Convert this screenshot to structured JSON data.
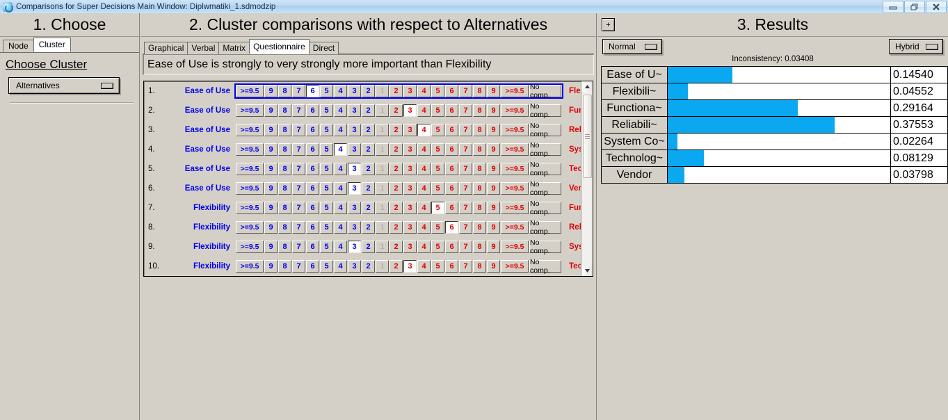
{
  "window": {
    "title": "Comparisons for Super Decisions Main Window: Diplwmatiki_1.sdmodzip",
    "icon": "app-refresh-icon",
    "controls": {
      "minimize": "minimize-icon",
      "restore": "restore-icon",
      "close": "close-icon"
    }
  },
  "left_panel": {
    "header": "1. Choose",
    "tabs": [
      {
        "label": "Node",
        "active": false
      },
      {
        "label": "Cluster",
        "active": true
      }
    ],
    "section_title": "Choose Cluster",
    "cluster_select": {
      "value": "Alternatives",
      "handle_icon": "dropdown-handle-icon"
    }
  },
  "middle_panel": {
    "header": "2. Cluster comparisons with respect to Alternatives",
    "tabs": [
      {
        "label": "Graphical",
        "active": false
      },
      {
        "label": "Verbal",
        "active": false
      },
      {
        "label": "Matrix",
        "active": false
      },
      {
        "label": "Questionnaire",
        "active": true
      },
      {
        "label": "Direct",
        "active": false
      }
    ],
    "prompt": "Ease of Use is strongly to very strongly more important than  Flexibility",
    "scale": {
      "left_labels": [
        ">=9.5",
        "9",
        "8",
        "7",
        "6",
        "5",
        "4",
        "3",
        "2"
      ],
      "center_label": "1",
      "right_labels": [
        "2",
        "3",
        "4",
        "5",
        "6",
        "7",
        "8",
        "9",
        ">=9.5"
      ],
      "no_comparison_label": "No comp.",
      "left_color": "#0000ee",
      "right_color": "#e00000",
      "center_color": "#b6b2ab"
    },
    "rows": [
      {
        "num": "1.",
        "left": "Ease of Use",
        "right": "Flexibility",
        "side": "left",
        "value": "6",
        "selected_row": true
      },
      {
        "num": "2.",
        "left": "Ease of Use",
        "right": "Functionality",
        "side": "right",
        "value": "3",
        "selected_row": false
      },
      {
        "num": "3.",
        "left": "Ease of Use",
        "right": "Reliability",
        "side": "right",
        "value": "4",
        "selected_row": false
      },
      {
        "num": "4.",
        "left": "Ease of Use",
        "right": "System Cost",
        "side": "left",
        "value": "4",
        "selected_row": false
      },
      {
        "num": "5.",
        "left": "Ease of Use",
        "right": "Technology Adva~",
        "side": "left",
        "value": "3",
        "selected_row": false
      },
      {
        "num": "6.",
        "left": "Ease of Use",
        "right": "Vendor",
        "side": "left",
        "value": "3",
        "selected_row": false
      },
      {
        "num": "7.",
        "left": "Flexibility",
        "right": "Functionality",
        "side": "right",
        "value": "5",
        "selected_row": false
      },
      {
        "num": "8.",
        "left": "Flexibility",
        "right": "Reliability",
        "side": "right",
        "value": "6",
        "selected_row": false
      },
      {
        "num": "9.",
        "left": "Flexibility",
        "right": "System Cost",
        "side": "left",
        "value": "3",
        "selected_row": false
      },
      {
        "num": "10.",
        "left": "Flexibility",
        "right": "Technology Adva~",
        "side": "right",
        "value": "3",
        "selected_row": false
      }
    ],
    "scrollbar": {
      "up_icon": "scroll-up-arrow-icon",
      "down_icon": "scroll-down-arrow-icon",
      "thumb_icon": "scrollbar-thumb-grip-icon"
    }
  },
  "right_panel": {
    "header": "3. Results",
    "expand_button": "+",
    "mode_select": {
      "value": "Normal",
      "handle_icon": "dropdown-handle-icon"
    },
    "type_select": {
      "value": "Hybrid",
      "handle_icon": "dropdown-handle-icon"
    },
    "inconsistency": "Inconsistency: 0.03408",
    "bar_color": "#0aa8f0"
  },
  "chart_data": {
    "type": "bar",
    "title": "3. Results",
    "annotations": [
      "Inconsistency: 0.03408"
    ],
    "orientation": "horizontal",
    "categories": [
      "Ease of U~",
      "Flexibili~",
      "Functiona~",
      "Reliabili~",
      "System Co~",
      "Technolog~",
      "Vendor"
    ],
    "values": [
      0.1454,
      0.04552,
      0.29164,
      0.37553,
      0.02264,
      0.08129,
      0.03798
    ],
    "value_labels": [
      "0.14540",
      "0.04552",
      "0.29164",
      "0.37553",
      "0.02264",
      "0.08129",
      "0.03798"
    ],
    "xlabel": "",
    "ylabel": "",
    "xlim": [
      0,
      0.5
    ],
    "grid": false,
    "legend": "none",
    "bar_color": "#0aa8f0"
  }
}
